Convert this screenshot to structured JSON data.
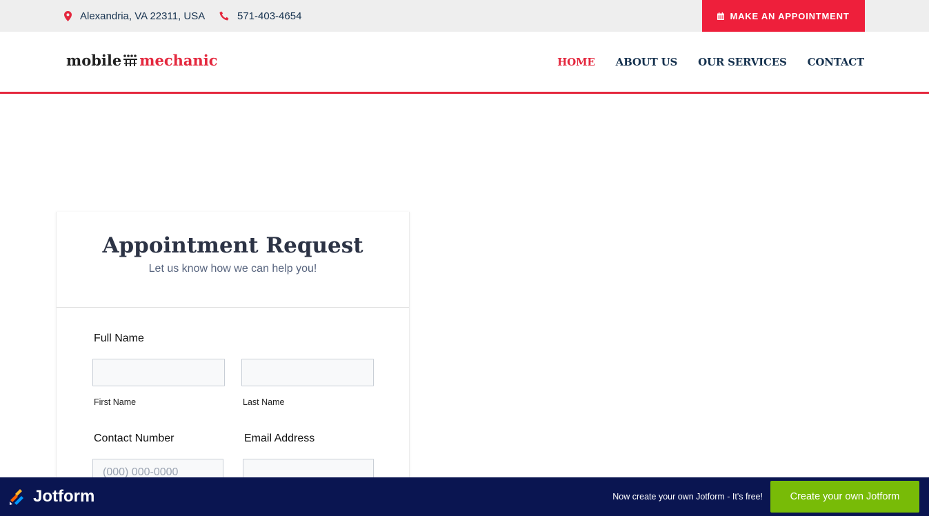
{
  "topbar": {
    "address": "Alexandria, VA 22311, USA",
    "phone": "571-403-4654",
    "appointment_button": "MAKE AN APPOINTMENT",
    "icons": {
      "address": "map-pin-icon",
      "phone": "phone-icon",
      "appointment": "calendar-icon"
    }
  },
  "logo": {
    "word1": "mobile",
    "word2": "mechanic",
    "icon": "gear-grid-icon"
  },
  "nav": {
    "items": [
      {
        "label": "HOME",
        "active": true
      },
      {
        "label": "ABOUT US",
        "active": false
      },
      {
        "label": "OUR SERVICES",
        "active": false
      },
      {
        "label": "CONTACT",
        "active": false
      }
    ]
  },
  "form": {
    "title": "Appointment Request",
    "subtitle": "Let us know how we can help you!",
    "full_name_label": "Full Name",
    "first_name_sublabel": "First Name",
    "last_name_sublabel": "Last Name",
    "contact_label": "Contact Number",
    "contact_placeholder": "(000) 000-0000",
    "email_label": "Email Address"
  },
  "jotform": {
    "brand": "Jotform",
    "promo_text": "Now create your own Jotform - It's free!",
    "button": "Create your own Jotform"
  },
  "colors": {
    "accent_red": "#ee1f3b",
    "navy": "#16324f",
    "jot_bar": "#0a1551",
    "jot_green": "#78bb07"
  }
}
